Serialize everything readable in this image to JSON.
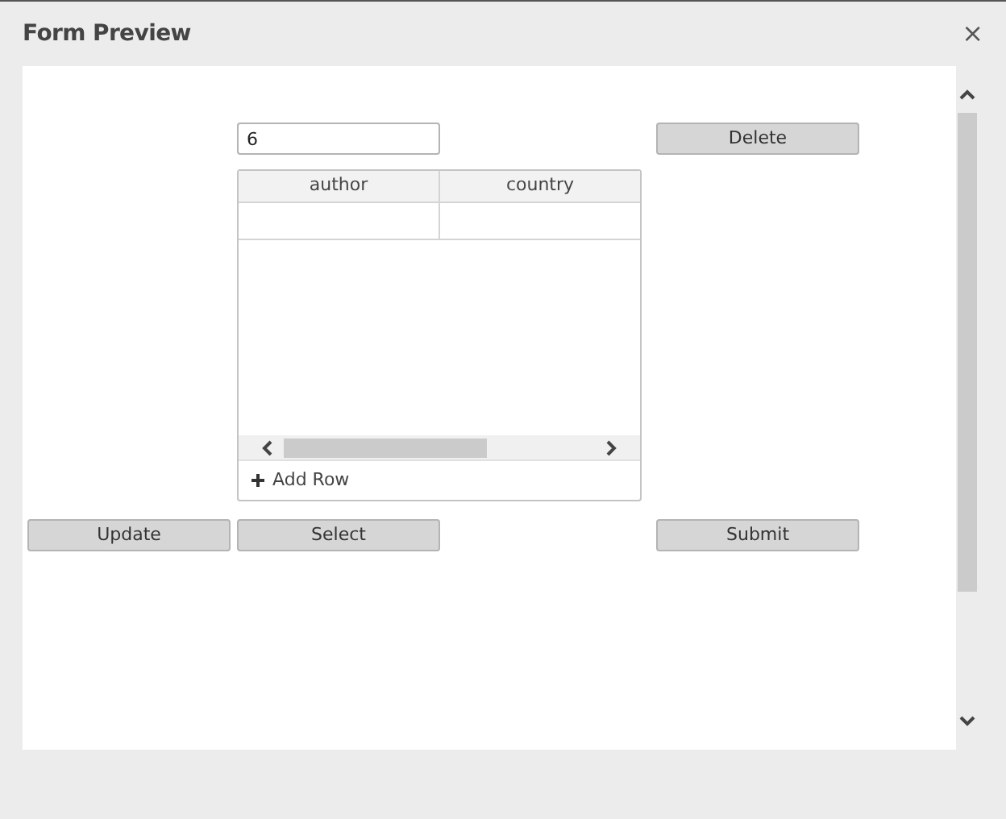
{
  "window": {
    "title": "Form Preview",
    "close": "×"
  },
  "number_field": {
    "value": "6"
  },
  "delete_button": "Delete",
  "table": {
    "columns": [
      "author",
      "country"
    ],
    "add_row": "Add Row"
  },
  "buttons": [
    "Update",
    "Select",
    "Submit"
  ]
}
